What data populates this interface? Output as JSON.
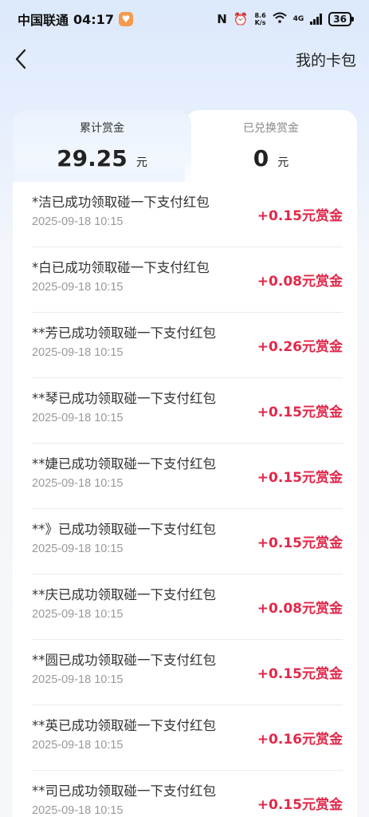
{
  "status": {
    "carrier": "中国联通",
    "time": "04:17",
    "nfc": "N",
    "alarm": "⏰",
    "speed_value": "8.6",
    "speed_unit": "K/s",
    "wifi": "6",
    "network": "4G",
    "battery": "36"
  },
  "nav": {
    "title": "我的卡包"
  },
  "summary": {
    "earned_label": "累计赏金",
    "earned_value": "29.25",
    "earned_unit": "元",
    "redeemed_label": "已兑换赏金",
    "redeemed_value": "0",
    "redeemed_unit": "元"
  },
  "records": [
    {
      "title": "*洁已成功领取碰一下支付红包",
      "time": "2025-09-18 10:15",
      "amount": "+0.15元赏金"
    },
    {
      "title": "*白已成功领取碰一下支付红包",
      "time": "2025-09-18 10:15",
      "amount": "+0.08元赏金"
    },
    {
      "title": "**芳已成功领取碰一下支付红包",
      "time": "2025-09-18 10:15",
      "amount": "+0.26元赏金"
    },
    {
      "title": "**琴已成功领取碰一下支付红包",
      "time": "2025-09-18 10:15",
      "amount": "+0.15元赏金"
    },
    {
      "title": "**婕已成功领取碰一下支付红包",
      "time": "2025-09-18 10:15",
      "amount": "+0.15元赏金"
    },
    {
      "title": "**》已成功领取碰一下支付红包",
      "time": "2025-09-18 10:15",
      "amount": "+0.15元赏金"
    },
    {
      "title": "**庆已成功领取碰一下支付红包",
      "time": "2025-09-18 10:15",
      "amount": "+0.08元赏金"
    },
    {
      "title": "**圆已成功领取碰一下支付红包",
      "time": "2025-09-18 10:15",
      "amount": "+0.15元赏金"
    },
    {
      "title": "**英已成功领取碰一下支付红包",
      "time": "2025-09-18 10:15",
      "amount": "+0.16元赏金"
    },
    {
      "title": "**司已成功领取碰一下支付红包",
      "time": "2025-09-18 10:15",
      "amount": "+0.15元赏金"
    }
  ]
}
